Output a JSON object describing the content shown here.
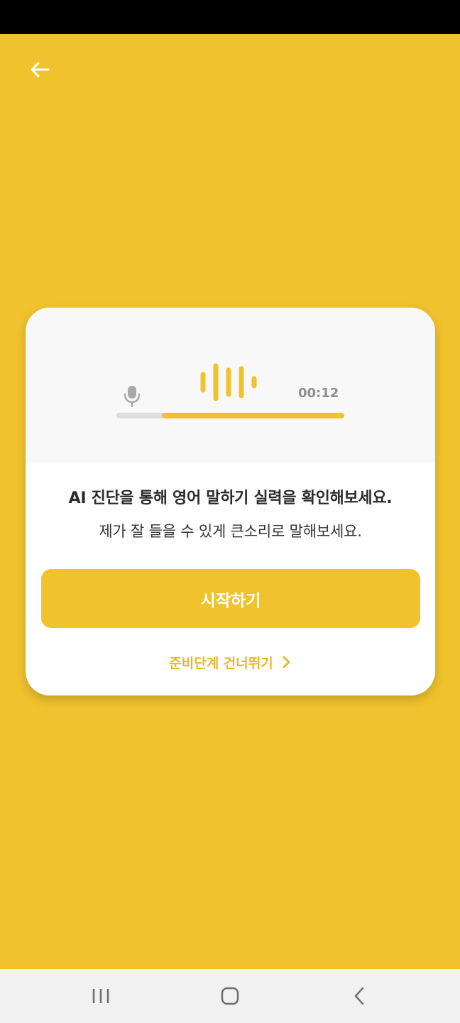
{
  "colors": {
    "accent": "#F0C22E",
    "card_background": "#FFFFFF",
    "card_top_background": "#F8F8F8",
    "track": "#DDDDDD",
    "timer_text": "#8E8E8E",
    "headline_text": "#2B2B2B",
    "skip_text": "#E8B82A",
    "nav_background": "#F1F1F1"
  },
  "header": {
    "back_icon": "arrow-left-icon"
  },
  "recorder": {
    "mic_icon": "microphone-icon",
    "wave_icon": "sound-wave-icon",
    "time": "00:12",
    "progress": 0.8
  },
  "card": {
    "headline": "AI 진단을 통해 영어 말하기 실력을 확인해보세요.",
    "subline": "제가 잘 들을 수 있게 큰소리로 말해보세요.",
    "start_label": "시작하기",
    "skip_label": "준비단계 건너뛰기",
    "skip_icon": "chevron-right-icon"
  },
  "nav": {
    "recent_icon": "recent-apps-icon",
    "home_icon": "home-icon",
    "back_icon": "back-icon"
  }
}
